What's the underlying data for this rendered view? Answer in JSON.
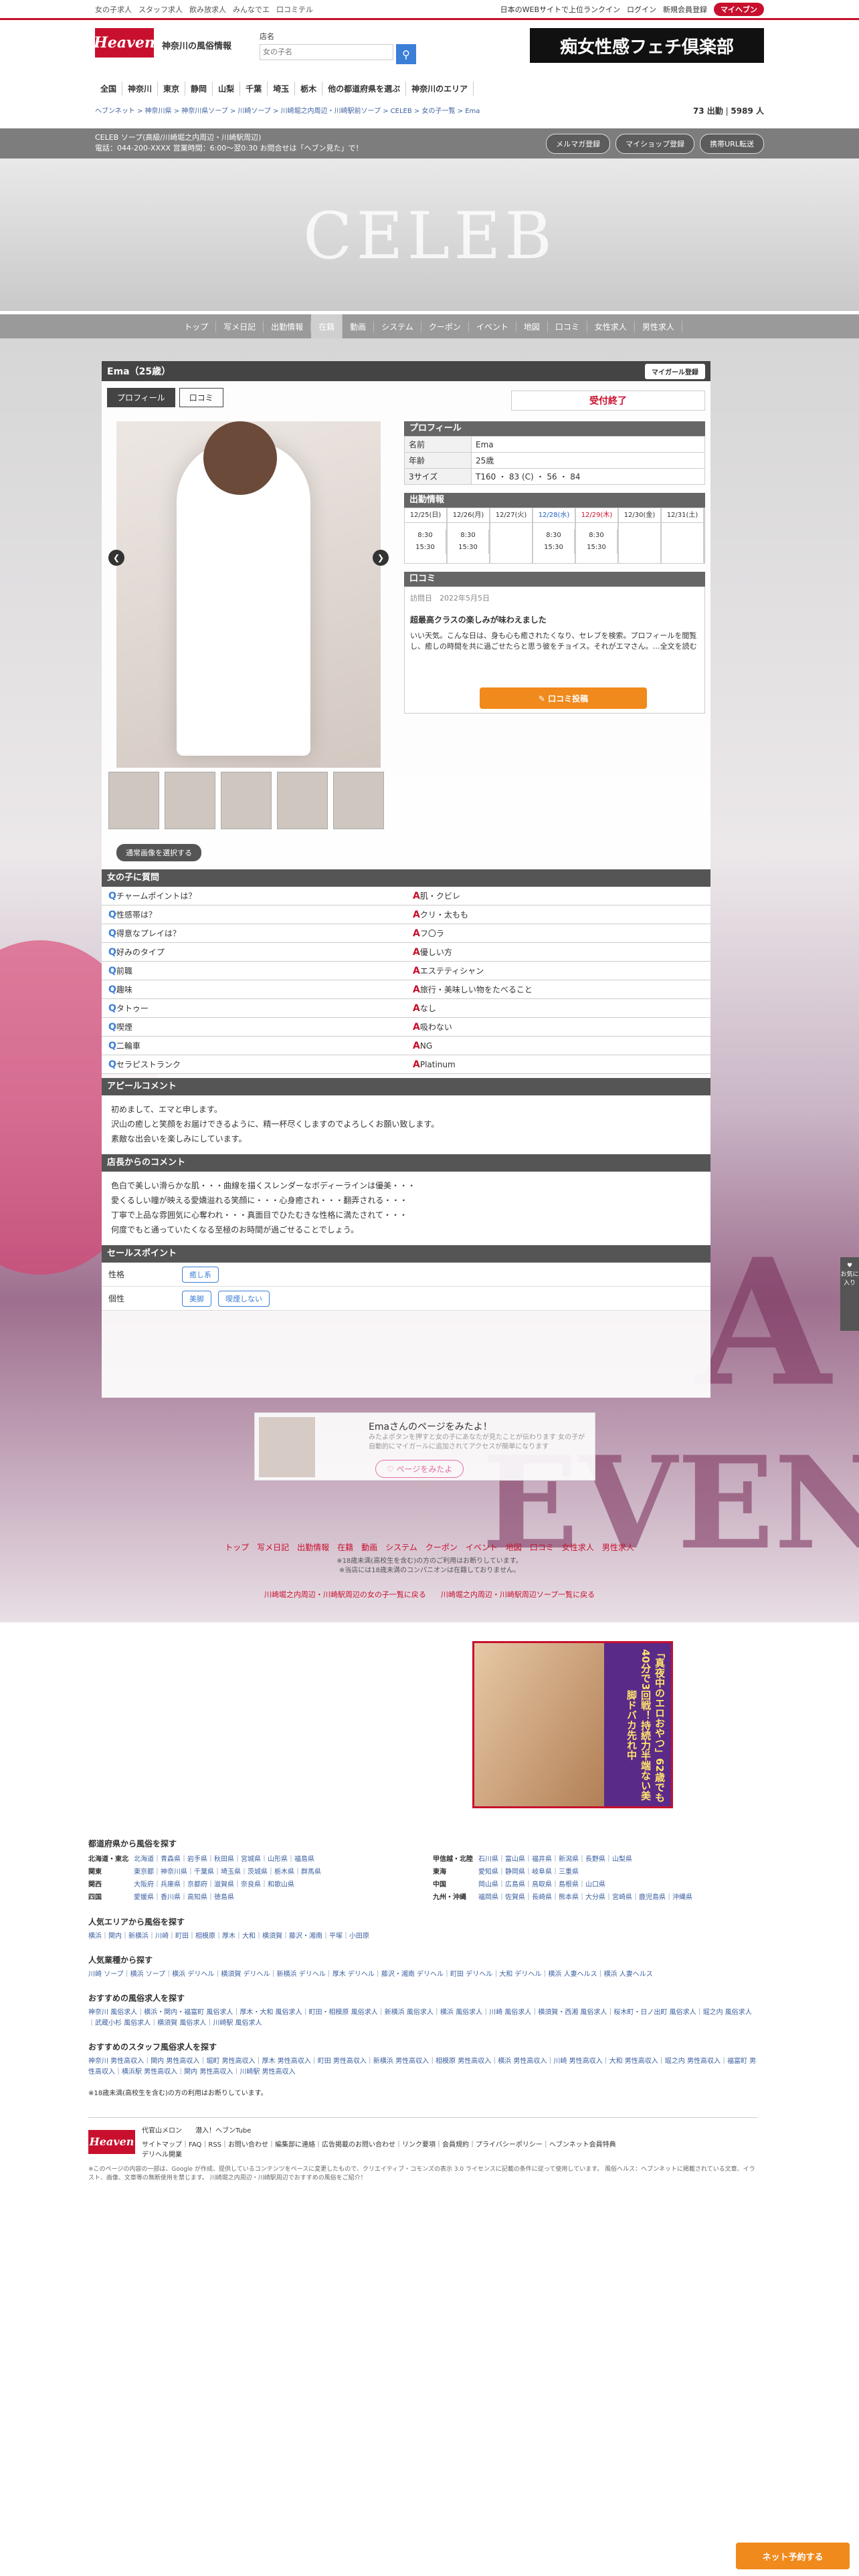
{
  "topbar": {
    "links": [
      "女の子求人",
      "スタッフ求人",
      "飲み放求人",
      "みんなでエ",
      "口コミテル"
    ],
    "right": [
      "日本のWEBサイトで上位ランクイン",
      "ログイン",
      "新規会員登録"
    ],
    "myheaven": "マイヘブン"
  },
  "header": {
    "logo": "Heaven",
    "region": "神奈川の風俗情報",
    "search_label": "店名",
    "search_placeholder": "女の子名",
    "banner": "痴女性感フェチ倶楽部"
  },
  "areanav": [
    "全国",
    "神奈川",
    "東京",
    "静岡",
    "山梨",
    "千葉",
    "埼玉",
    "栃木",
    "他の都道府県を選ぶ",
    "神奈川のエリア"
  ],
  "crumb": {
    "path": "ヘブンネット > 神奈川県 > 神奈川県ソープ > 川崎ソープ > 川崎堀之内周辺・川崎駅前ソープ > CELEB > 女の子一覧 > Ema",
    "count_label": "73 出勤",
    "count_total": "5989 人"
  },
  "shop": {
    "line1": "CELEB ソープ(高級/川崎堀之内周辺・川崎駅周辺)",
    "line2": "電話：044-200-XXXX 営業時間：6:00～翌0:30 お問合せは「ヘブン見た」で！",
    "buttons": [
      "メルマガ登録",
      "マイショップ登録",
      "携帯URL転送"
    ]
  },
  "hero": {
    "text": "CELEB"
  },
  "shopnav": [
    "トップ",
    "写メ日記",
    "出勤情報",
    "在籍",
    "動画",
    "システム",
    "クーポン",
    "イベント",
    "地図",
    "口コミ",
    "女性求人",
    "男性求人"
  ],
  "profile": {
    "title": "Ema（25歳）",
    "mygirl": "マイガール登録",
    "tabs": [
      "プロフィール",
      "口コミ"
    ],
    "status": "受付終了",
    "swap": "通常画像を選択する",
    "sec_profile": "プロフィール",
    "rows": [
      {
        "k": "名前",
        "v": "Ema"
      },
      {
        "k": "年齢",
        "v": "25歳"
      },
      {
        "k": "3サイズ",
        "v": "T160 ・ 83 (C) ・ 56 ・ 84"
      }
    ],
    "sec_sched": "出勤情報",
    "days": [
      {
        "d": "12/25(日)",
        "t1": "8:30",
        "t2": "15:30",
        "c": ""
      },
      {
        "d": "12/26(月)",
        "t1": "8:30",
        "t2": "15:30",
        "c": ""
      },
      {
        "d": "12/27(火)",
        "t1": "",
        "t2": "",
        "c": ""
      },
      {
        "d": "12/28(水)",
        "t1": "8:30",
        "t2": "15:30",
        "c": "sat"
      },
      {
        "d": "12/29(木)",
        "t1": "8:30",
        "t2": "15:30",
        "c": "sun"
      },
      {
        "d": "12/30(金)",
        "t1": "",
        "t2": "",
        "c": ""
      },
      {
        "d": "12/31(土)",
        "t1": "",
        "t2": "",
        "c": ""
      }
    ],
    "sec_kuchi": "口コミ",
    "kuchi_date": "訪問日　2022年5月5日",
    "kuchi_title": "超最高クラスの楽しみが味わえました",
    "kuchi_body": "いい天気。こんな日は、身も心も癒されたくなり、セレブを検索。プロフィールを閲覧し、癒しの時間を共に過ごせたらと思う彼をチョイス。それがエマさん。…全文を読む",
    "kuchi_btn": "✎ 口コミ投稿"
  },
  "qa": {
    "title": "女の子に質問",
    "items": [
      {
        "q": "チャームポイントは？",
        "a": "肌・クビレ"
      },
      {
        "q": "性感帯は？",
        "a": "クリ・太もも"
      },
      {
        "q": "得意なプレイは？",
        "a": "フ〇ラ"
      },
      {
        "q": "好みのタイプ",
        "a": "優しい方"
      },
      {
        "q": "前職",
        "a": "エステティシャン"
      },
      {
        "q": "趣味",
        "a": "旅行・美味しい物をたべること"
      },
      {
        "q": "タトゥー",
        "a": "なし"
      },
      {
        "q": "喫煙",
        "a": "吸わない"
      },
      {
        "q": "二輪車",
        "a": "NG"
      },
      {
        "q": "セラピストランク",
        "a": "Platinum"
      }
    ]
  },
  "appeal": {
    "title": "アピールコメント",
    "lines": [
      "初めまして、エマと申します。",
      "沢山の癒しと笑顔をお届けできるように、精一杯尽くしますのでよろしくお願い致します。",
      "素敵な出会いを楽しみにしています。"
    ]
  },
  "shopcomment": {
    "title": "店長からのコメント",
    "lines": [
      "色白で美しい滑らかな肌・・・曲線を描くスレンダーなボディーラインは優美・・・",
      "愛くるしい瞳が映える愛嬌溢れる笑顔に・・・心身癒され・・・翻弄される・・・",
      "丁寧で上品な雰囲気に心奪われ・・・真面目でひたむきな性格に満たされて・・・",
      "何度でもと通っていたくなる至極のお時間が過ごせることでしょう。"
    ]
  },
  "sales": {
    "title": "セールスポイント",
    "rows": [
      {
        "k": "性格",
        "tags": [
          "癒し系"
        ]
      },
      {
        "k": "個性",
        "tags": [
          "美脚",
          "喫煙しない"
        ]
      }
    ]
  },
  "mypop": {
    "t1": "Emaさんのページをみたよ！",
    "t2": "みたよボタンを押すと女の子にあなたが見たことが伝わります 女の子が自動的にマイガールに追加されてアクセスが簡単になります",
    "btn": "♡ ページをみたよ"
  },
  "footnav": {
    "items": [
      "トップ",
      "写メ日記",
      "出勤情報",
      "在籍",
      "動画",
      "システム",
      "クーポン",
      "イベント",
      "地図",
      "口コミ",
      "女性求人",
      "男性求人"
    ],
    "note1": "※18歳未満(高校生を含む)の方のご利用はお断りしています。",
    "note2": "※当店には18歳未満のコンパニオンは在籍しておりません。",
    "links": "川崎堀之内周辺・川崎駅周辺の女の子一覧に戻る　　川崎堀之内周辺・川崎駅周辺ソープ一覧に戻る"
  },
  "ad": {
    "text": "「真夜中のエロおやつ」62歳でも40分で3回戦！持続力半端ない美脚ドバカ先れ中"
  },
  "footer": {
    "pref_title": "都道府県から風俗を探す",
    "prefs": [
      {
        "r": "北海道・東北",
        "p": "北海道｜青森県｜岩手県｜秋田県｜宮城県｜山形県｜福島県"
      },
      {
        "r": "甲信越・北陸",
        "p": "石川県｜富山県｜福井県｜新潟県｜長野県｜山梨県"
      },
      {
        "r": "関東",
        "p": "東京都｜神奈川県｜千葉県｜埼玉県｜茨城県｜栃木県｜群馬県"
      },
      {
        "r": "東海",
        "p": "愛知県｜静岡県｜岐阜県｜三重県"
      },
      {
        "r": "関西",
        "p": "大阪府｜兵庫県｜京都府｜滋賀県｜奈良県｜和歌山県"
      },
      {
        "r": "中国",
        "p": "岡山県｜広島県｜鳥取県｜島根県｜山口県"
      },
      {
        "r": "四国",
        "p": "愛媛県｜香川県｜高知県｜徳島県"
      },
      {
        "r": "九州・沖縄",
        "p": "福岡県｜佐賀県｜長崎県｜熊本県｜大分県｜宮崎県｜鹿児島県｜沖縄県"
      }
    ],
    "pop_area_title": "人気エリアから風俗を探す",
    "pop_area": "横浜｜関内｜新横浜｜川崎｜町田｜相模原｜厚木｜大和｜横須賀｜藤沢・湘南｜平塚｜小田原",
    "pop_type_title": "人気業種から探す",
    "pop_type": "川崎 ソープ｜横浜 ソープ｜横浜 デリヘル｜横須賀 デリヘル｜新横浜 デリヘル｜厚木 デリヘル｜藤沢・湘南 デリヘル｜町田 デリヘル｜大和 デリヘル｜横浜 人妻ヘルス｜横浜 人妻ヘルス",
    "job_title": "おすすめの風俗求人を探す",
    "job": "神奈川 風俗求人｜横浜・関内・福富町 風俗求人｜厚木・大和 風俗求人｜町田・相模原 風俗求人｜新横浜 風俗求人｜横浜 風俗求人｜川崎 風俗求人｜横須賀・西湘 風俗求人｜桜木町・日ノ出町 風俗求人｜堀之内 風俗求人｜武蔵小杉 風俗求人｜横須賀 風俗求人｜川崎駅 風俗求人",
    "staff_title": "おすすめのスタッフ風俗求人を探す",
    "staff": "神奈川 男性高収入｜関内 男性高収入｜堀町 男性高収入｜厚木 男性高収入｜町田 男性高収入｜新横浜 男性高収入｜相模原 男性高収入｜横浜 男性高収入｜川崎 男性高収入｜大和 男性高収入｜堀之内 男性高収入｜福富町 男性高収入｜横浜駅 男性高収入｜関内 男性高収入｜川崎駅 男性高収入",
    "under18": "※18歳未満(高校生を含む)の方の利用はお断りしています。",
    "links2": "代官山メロン　　潜入！ヘブンTube",
    "links3": "サイトマップ｜FAQ｜RSS｜お問い合わせ｜編集部に連絡｜広告掲載のお問い合わせ｜リンク要項｜会員規約｜プライバシーポリシー｜ヘブンネット会員特典",
    "links3b": "デリヘル開業",
    "copy": "※このページの内容の一部は、Google が作成、提供しているコンテンツをベースに変更したもので、クリエイティブ・コモンズの表示 3.0 ライセンスに記載の条件に従って使用しています。 風俗ヘルス：ヘブンネットに掲載されている文章、イラスト、画像、文章等の無断使用を禁じます。 川崎堀之内周辺・川崎駅周辺でおすすめの風俗をご紹介！"
  },
  "side": {
    "label": "お気に入り"
  },
  "stock": "ネット予約する"
}
